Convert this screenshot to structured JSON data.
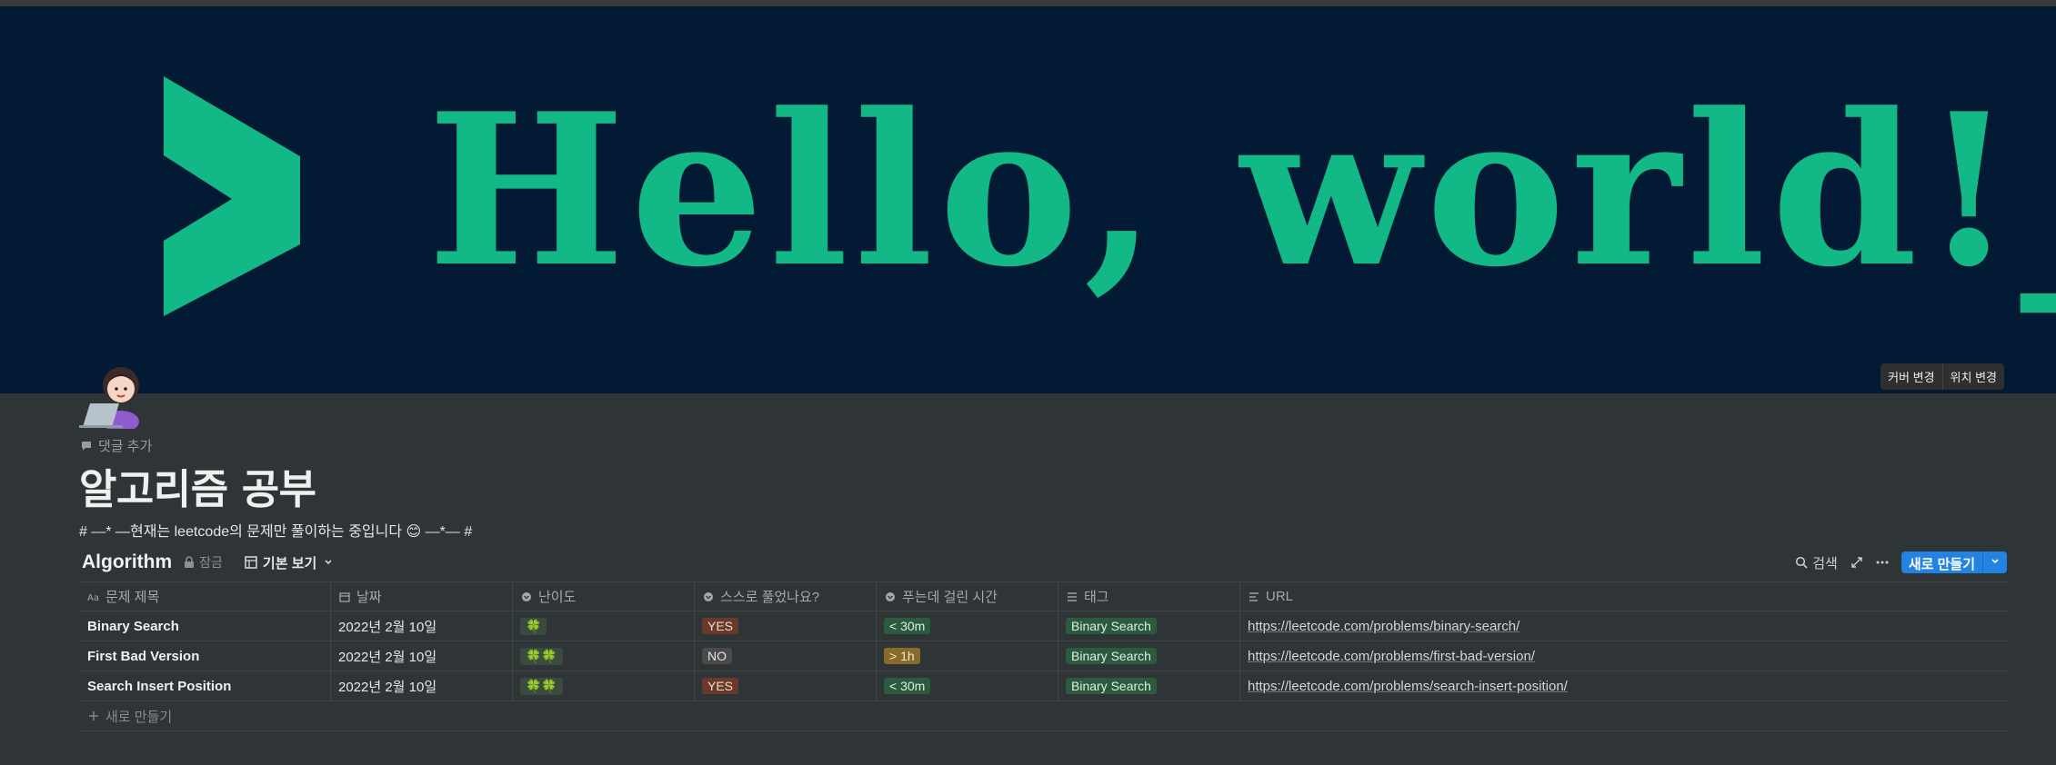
{
  "cover": {
    "text": "Hello, world!_",
    "change_cover_label": "커버 변경",
    "reposition_label": "위치 변경",
    "bg_color": "#021a33",
    "accent_color": "#12b886"
  },
  "page": {
    "icon": "woman-technologist-emoji",
    "add_comment_label": "댓글 추가",
    "title": "알고리즘 공부",
    "description": "# —* —현재는 leetcode의 문제만 풀이하는 중입니다 😊 —*— #"
  },
  "database": {
    "name": "Algorithm",
    "lock_label": "잠금",
    "view_label": "기본 보기",
    "search_label": "검색",
    "new_button_label": "새로 만들기",
    "columns": [
      {
        "label": "문제 제목",
        "icon": "text-icon"
      },
      {
        "label": "날짜",
        "icon": "calendar-icon"
      },
      {
        "label": "난이도",
        "icon": "select-icon"
      },
      {
        "label": "스스로 풀었나요?",
        "icon": "select-icon"
      },
      {
        "label": "푸는데 걸린 시간",
        "icon": "select-icon"
      },
      {
        "label": "태그",
        "icon": "multiselect-icon"
      },
      {
        "label": "URL",
        "icon": "url-icon"
      }
    ],
    "rows": [
      {
        "title": "Binary Search",
        "date": "2022년 2월 10일",
        "difficulty": "🍀",
        "self_solved": "YES",
        "time": "< 30m",
        "tag": "Binary Search",
        "url": "https://leetcode.com/problems/binary-search/"
      },
      {
        "title": "First Bad Version",
        "date": "2022년 2월 10일",
        "difficulty": "🍀🍀",
        "self_solved": "NO",
        "time": "> 1h",
        "tag": "Binary Search",
        "url": "https://leetcode.com/problems/first-bad-version/"
      },
      {
        "title": "Search Insert Position",
        "date": "2022년 2월 10일",
        "difficulty": "🍀🍀",
        "self_solved": "YES",
        "time": "< 30m",
        "tag": "Binary Search",
        "url": "https://leetcode.com/problems/search-insert-position/"
      }
    ],
    "add_row_label": "새로 만들기"
  }
}
